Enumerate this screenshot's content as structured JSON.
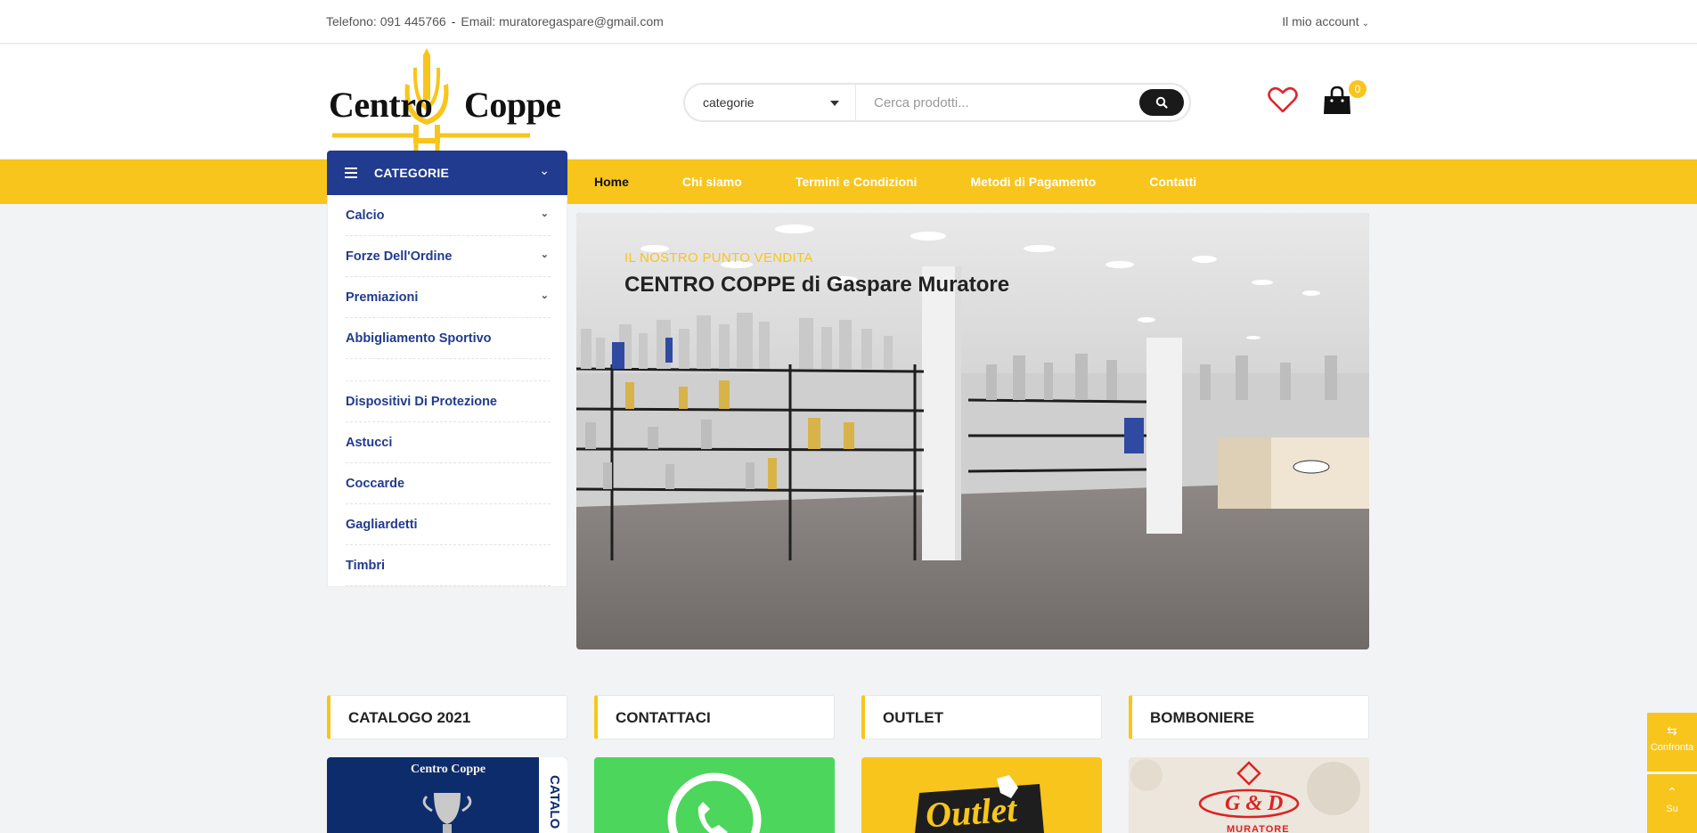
{
  "topbar": {
    "phone": "Telefono: 091 445766",
    "separator": "-",
    "email": "Email: muratoregaspare@gmail.com",
    "account": "Il mio account"
  },
  "logo": {
    "left_word": "Centro",
    "right_word": "Coppe"
  },
  "search": {
    "category": "categorie",
    "placeholder": "Cerca prodotti..."
  },
  "cart": {
    "count": "0"
  },
  "nav": {
    "items": [
      "Home",
      "Chi siamo",
      "Termini e Condizioni",
      "Metodi di Pagamento",
      "Contatti"
    ]
  },
  "categories": {
    "title": "CATEGORIE",
    "items": [
      {
        "label": "Calcio"
      },
      {
        "label": "Forze Dell'Ordine"
      },
      {
        "label": "Premiazioni"
      },
      {
        "label": "Abbigliamento Sportivo"
      },
      {
        "label": ""
      },
      {
        "label": "Dispositivi Di Protezione"
      },
      {
        "label": "Astucci"
      },
      {
        "label": "Coccarde"
      },
      {
        "label": "Gagliardetti"
      },
      {
        "label": "Timbri"
      }
    ]
  },
  "hero": {
    "eyebrow": "IL NOSTRO PUNTO VENDITA",
    "headline": "CENTRO COPPE di Gaspare Muratore"
  },
  "sections": [
    "CATALOGO 2021",
    "CONTATTACI",
    "OUTLET",
    "BOMBONIERE"
  ],
  "tiles": {
    "catalogo_brand": "Centro Coppe",
    "catalogo_side": "CATALO",
    "outlet_word": "Outlet",
    "bomboniere_mono": "G & D",
    "bomboniere_name": "MURATORE"
  },
  "side": {
    "compare": "Confronta",
    "top": "Su"
  },
  "colors": {
    "yellow": "#f8c51c",
    "navy": "#213b8e",
    "dark": "#1a1a1a",
    "wish_red": "#e0242a"
  }
}
